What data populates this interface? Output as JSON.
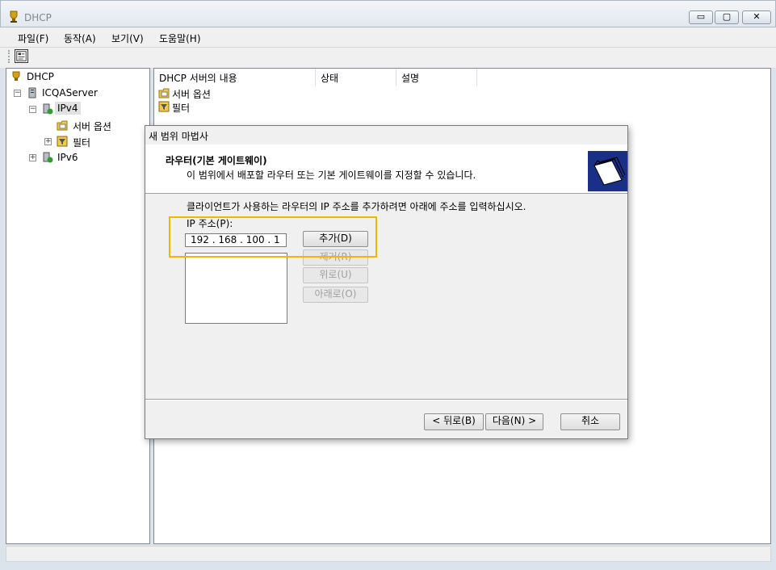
{
  "window": {
    "title": "DHCP",
    "minimize_glyph": "▭",
    "maximize_glyph": "▢",
    "close_glyph": "✕"
  },
  "menu": [
    "파일(F)",
    "동작(A)",
    "보기(V)",
    "도움말(H)"
  ],
  "tree": {
    "root": "DHCP",
    "server": "ICQAServer",
    "ipv4": "IPv4",
    "server_options": "서버 옵션",
    "filters": "필터",
    "ipv6": "IPv6",
    "expand_glyph": "+",
    "collapse_glyph": "−"
  },
  "details": {
    "columns": [
      "DHCP 서버의 내용",
      "상태",
      "설명"
    ],
    "items": [
      "서버 옵션",
      "필터"
    ]
  },
  "wizard": {
    "title": "새 범위 마법사",
    "header_title": "라우터(기본 게이트웨이)",
    "header_subtitle": "이 범위에서 배포할 라우터 또는 기본 게이트웨이를 지정할 수 있습니다.",
    "instruction": "클라이언트가 사용하는 라우터의 IP 주소를 추가하려면 아래에 주소를 입력하십시오.",
    "ip_label": "IP 주소(P):",
    "ip_value": "192 . 168 . 100 .   1",
    "add_button": "추가(D)",
    "remove_button": "제거(R)",
    "up_button": "위로(U)",
    "down_button": "아래로(O)",
    "back_button": "< 뒤로(B)",
    "next_button": "다음(N) >",
    "cancel_button": "취소",
    "highlight_color": "#f5b400"
  },
  "icons": {
    "app": "trophy-icon",
    "toolbar": "properties-icon",
    "server": "server-icon",
    "options": "folder-options-icon",
    "filter": "filter-icon",
    "wizard_art": "folders-icon"
  }
}
